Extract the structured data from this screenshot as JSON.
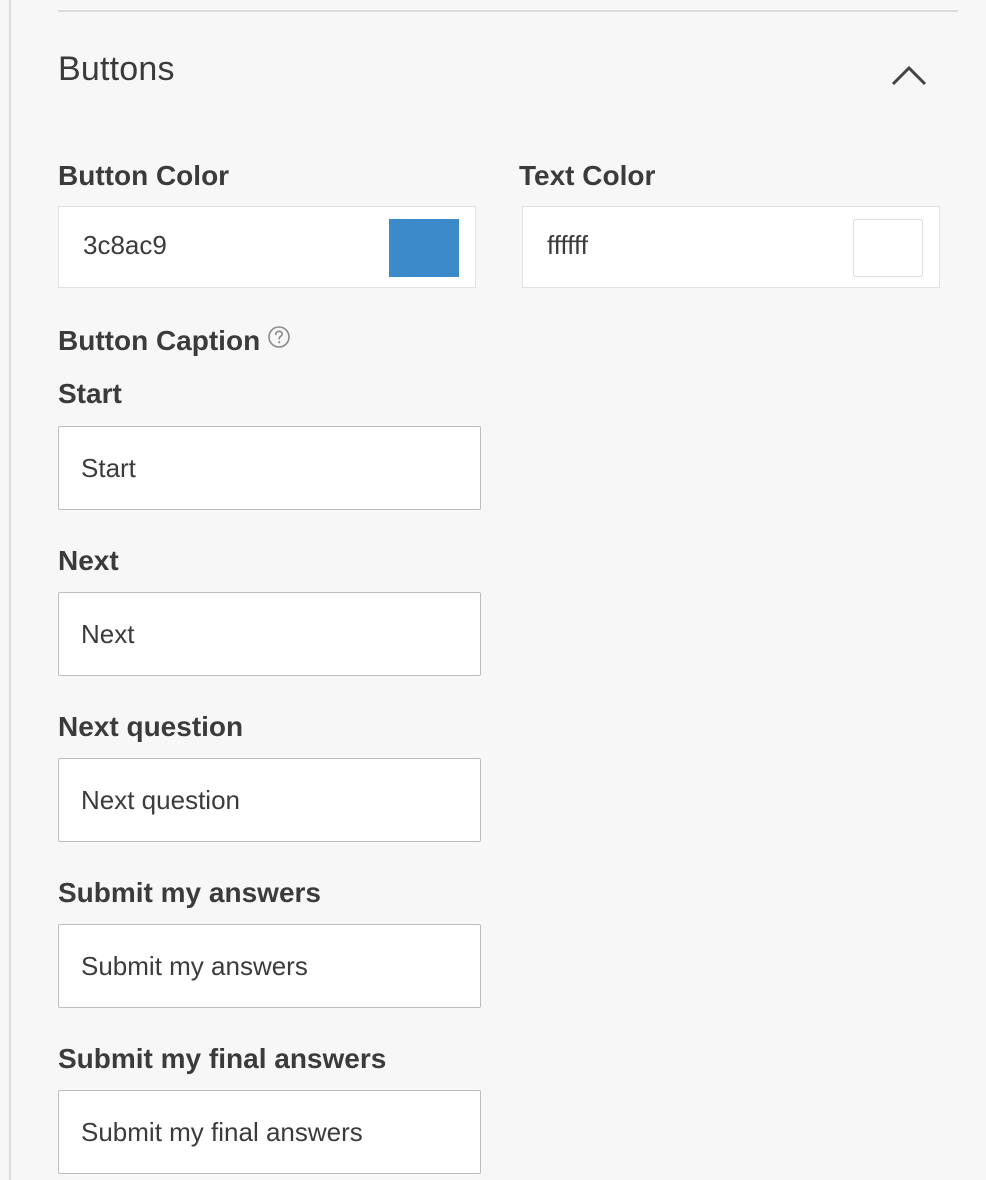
{
  "section": {
    "title": "Buttons",
    "collapse_icon": "chevron-up-icon"
  },
  "button_color": {
    "label": "Button Color",
    "value": "3c8ac9",
    "swatch": "#3c8ac9"
  },
  "text_color": {
    "label": "Text Color",
    "value": "ffffff",
    "swatch": "#ffffff"
  },
  "button_caption": {
    "label": "Button Caption",
    "help_icon": "question-circle-icon"
  },
  "captions": [
    {
      "label": "Start",
      "value": "Start"
    },
    {
      "label": "Next",
      "value": "Next"
    },
    {
      "label": "Next question",
      "value": "Next question"
    },
    {
      "label": "Submit my answers",
      "value": "Submit my answers"
    },
    {
      "label": "Submit my final answers",
      "value": "Submit my final answers"
    }
  ]
}
